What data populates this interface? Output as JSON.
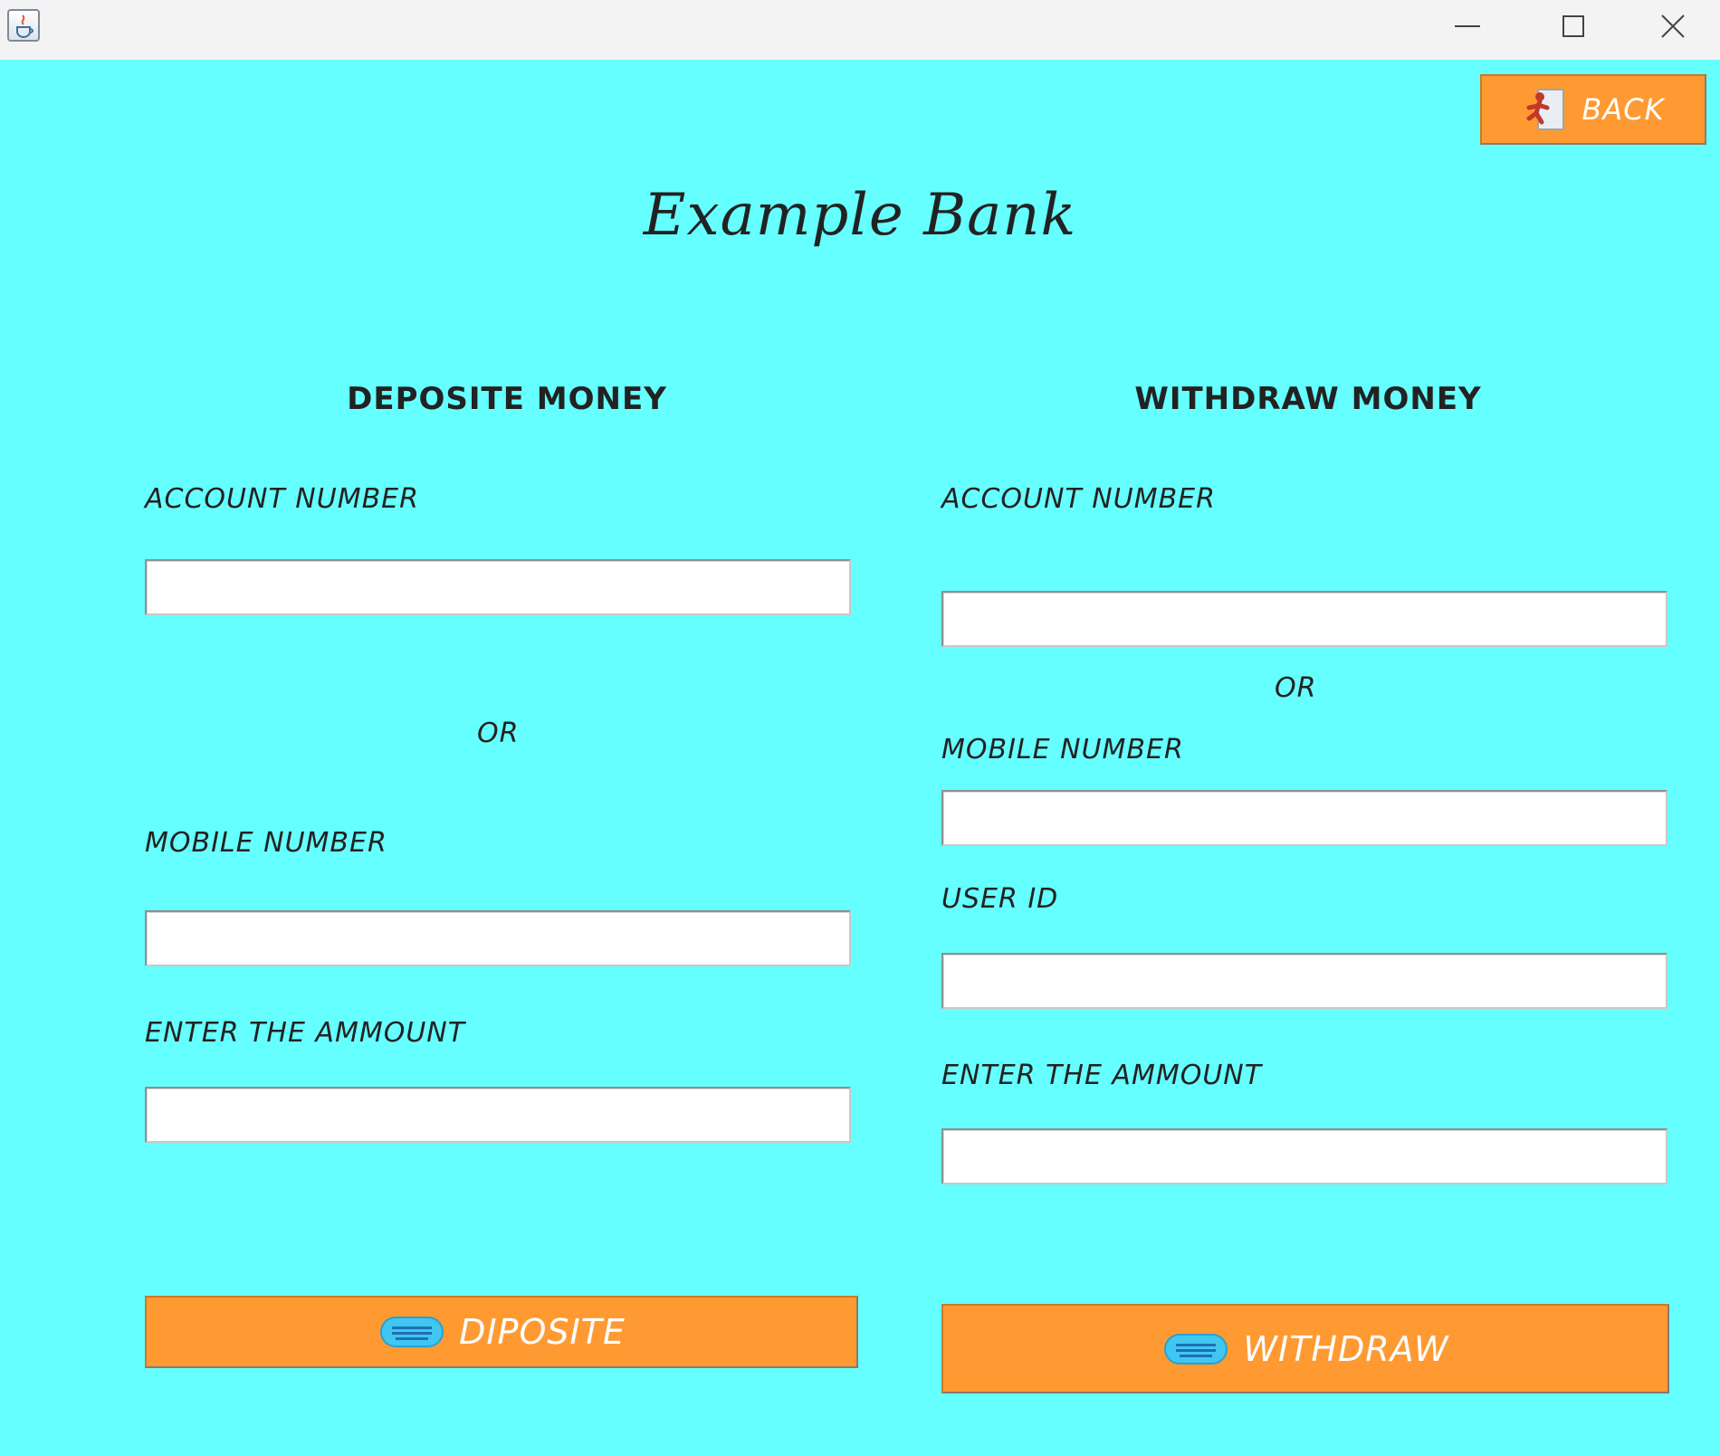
{
  "window": {
    "app_icon": "java-coffee-icon",
    "controls": [
      "minimize-icon",
      "maximize-icon",
      "close-icon"
    ]
  },
  "header": {
    "back_label": "BACK",
    "back_icon": "exit-door-icon",
    "title": "Example Bank"
  },
  "deposit": {
    "heading": "DEPOSITE MONEY",
    "account_label": "ACCOUNT NUMBER",
    "account_value": "",
    "or_label": "OR",
    "mobile_label": "MOBILE NUMBER",
    "mobile_value": "",
    "amount_label": "ENTER THE AMMOUNT",
    "amount_value": "",
    "button_label": "DIPOSITE",
    "button_icon": "cash-icon"
  },
  "withdraw": {
    "heading": "WITHDRAW MONEY",
    "account_label": "ACCOUNT NUMBER",
    "account_value": "",
    "or_label": "OR",
    "mobile_label": "MOBILE NUMBER",
    "mobile_value": "",
    "userid_label": "USER ID",
    "userid_value": "",
    "amount_label": "ENTER THE AMMOUNT",
    "amount_value": "",
    "button_label": "WITHDRAW",
    "button_icon": "cash-icon"
  },
  "colors": {
    "background": "#66ffff",
    "button": "#ff9a33",
    "titlebar": "#f3f3f3"
  }
}
